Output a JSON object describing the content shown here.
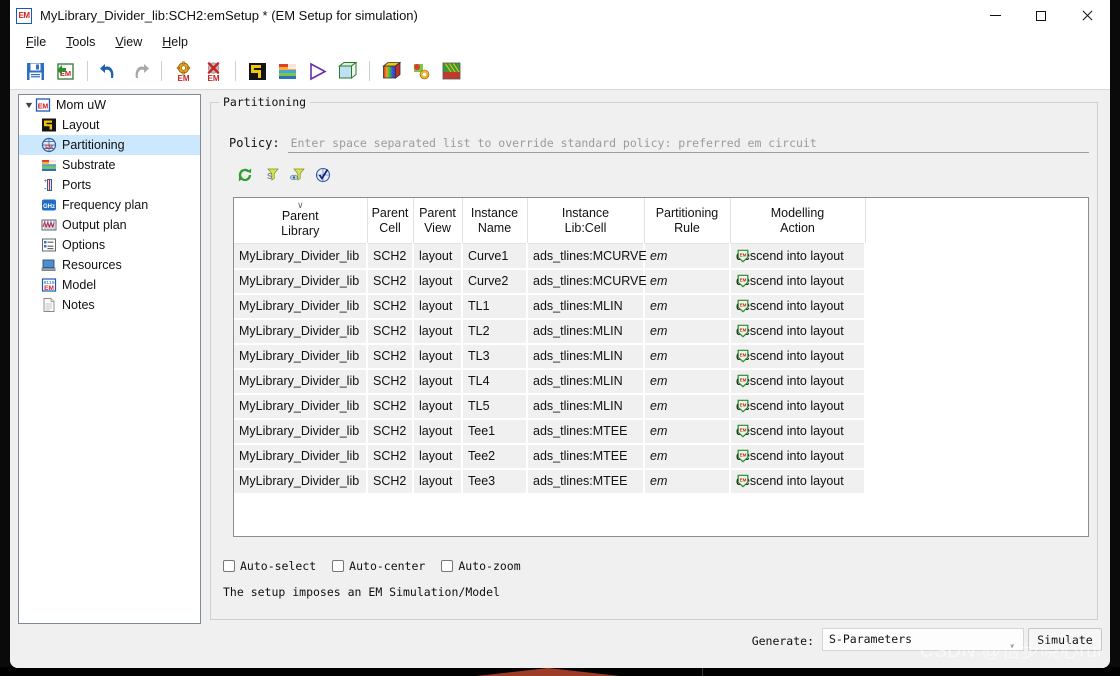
{
  "window": {
    "title": "MyLibrary_Divider_lib:SCH2:emSetup * (EM Setup for simulation)",
    "app_icon_label": "EM",
    "minimize_label": "Minimize",
    "maximize_label": "Maximize",
    "close_label": "Close"
  },
  "menu": {
    "items": [
      {
        "label": "File",
        "accel": "F"
      },
      {
        "label": "Tools",
        "accel": "T"
      },
      {
        "label": "View",
        "accel": "V"
      },
      {
        "label": "Help",
        "accel": "H"
      }
    ]
  },
  "toolbar": {
    "buttons": [
      {
        "name": "save-icon",
        "title": "Save"
      },
      {
        "name": "save-em-setup-icon",
        "title": "Save EM Setup"
      },
      {
        "name": "undo-icon",
        "title": "Undo"
      },
      {
        "name": "redo-icon",
        "title": "Redo"
      },
      {
        "name": "em-settings-icon",
        "title": "EM Setup"
      },
      {
        "name": "em-delete-icon",
        "title": "Remove EM Setup"
      },
      {
        "name": "layout-icon",
        "title": "Layout"
      },
      {
        "name": "substrate-icon",
        "title": "Substrate"
      },
      {
        "name": "simulate-icon",
        "title": "Simulate"
      },
      {
        "name": "cube-3d-icon",
        "title": "3D View"
      },
      {
        "name": "rainbow-cube-icon",
        "title": "Visualization"
      },
      {
        "name": "mesh-settings-icon",
        "title": "Mesh Settings"
      },
      {
        "name": "em-result-icon",
        "title": "EM Results"
      }
    ]
  },
  "sidebar": {
    "root": {
      "label": "Mom uW",
      "icon": "em-icon",
      "expanded": true
    },
    "items": [
      {
        "label": "Layout",
        "icon": "layout-icon",
        "selected": false
      },
      {
        "label": "Partitioning",
        "icon": "partitioning-icon",
        "selected": true
      },
      {
        "label": "Substrate",
        "icon": "substrate-icon",
        "selected": false
      },
      {
        "label": "Ports",
        "icon": "ports-icon",
        "selected": false
      },
      {
        "label": "Frequency plan",
        "icon": "ghz-icon",
        "selected": false
      },
      {
        "label": "Output plan",
        "icon": "output-plan-icon",
        "selected": false
      },
      {
        "label": "Options",
        "icon": "options-icon",
        "selected": false
      },
      {
        "label": "Resources",
        "icon": "resources-icon",
        "selected": false
      },
      {
        "label": "Model",
        "icon": "model-icon",
        "selected": false
      },
      {
        "label": "Notes",
        "icon": "notes-icon",
        "selected": false
      }
    ]
  },
  "panel": {
    "group_title": "Partitioning",
    "policy_label": "Policy:",
    "policy_value": "",
    "policy_placeholder": "Enter space separated list to override standard policy: preferred em circuit",
    "mini_toolbar": [
      {
        "name": "refresh-icon",
        "title": "Refresh"
      },
      {
        "name": "filter-s-icon",
        "title": "Filter schematic"
      },
      {
        "name": "filter-view-icon",
        "title": "Filter view"
      },
      {
        "name": "validate-em-icon",
        "title": "Validate"
      }
    ]
  },
  "table": {
    "sort_column": 0,
    "sort_indicator": "∨",
    "headers": [
      {
        "line1": "Parent",
        "line2": "Library"
      },
      {
        "line1": "Parent",
        "line2": "Cell"
      },
      {
        "line1": "Parent",
        "line2": "View"
      },
      {
        "line1": "Instance",
        "line2": "Name"
      },
      {
        "line1": "Instance",
        "line2": "Lib:Cell"
      },
      {
        "line1": "Partitioning",
        "line2": "Rule"
      },
      {
        "line1": "Modelling",
        "line2": "Action"
      }
    ],
    "rows": [
      {
        "parent_library": "MyLibrary_Divider_lib",
        "parent_cell": "SCH2",
        "parent_view": "layout",
        "instance_name": "Curve1",
        "instance_libcell": "ads_tlines:MCURVE",
        "rule": "em",
        "action": "descend into layout",
        "action_icon": "em-shield-icon"
      },
      {
        "parent_library": "MyLibrary_Divider_lib",
        "parent_cell": "SCH2",
        "parent_view": "layout",
        "instance_name": "Curve2",
        "instance_libcell": "ads_tlines:MCURVE",
        "rule": "em",
        "action": "descend into layout",
        "action_icon": "em-shield-icon"
      },
      {
        "parent_library": "MyLibrary_Divider_lib",
        "parent_cell": "SCH2",
        "parent_view": "layout",
        "instance_name": "TL1",
        "instance_libcell": "ads_tlines:MLIN",
        "rule": "em",
        "action": "descend into layout",
        "action_icon": "em-shield-icon"
      },
      {
        "parent_library": "MyLibrary_Divider_lib",
        "parent_cell": "SCH2",
        "parent_view": "layout",
        "instance_name": "TL2",
        "instance_libcell": "ads_tlines:MLIN",
        "rule": "em",
        "action": "descend into layout",
        "action_icon": "em-shield-icon"
      },
      {
        "parent_library": "MyLibrary_Divider_lib",
        "parent_cell": "SCH2",
        "parent_view": "layout",
        "instance_name": "TL3",
        "instance_libcell": "ads_tlines:MLIN",
        "rule": "em",
        "action": "descend into layout",
        "action_icon": "em-shield-icon"
      },
      {
        "parent_library": "MyLibrary_Divider_lib",
        "parent_cell": "SCH2",
        "parent_view": "layout",
        "instance_name": "TL4",
        "instance_libcell": "ads_tlines:MLIN",
        "rule": "em",
        "action": "descend into layout",
        "action_icon": "em-shield-icon"
      },
      {
        "parent_library": "MyLibrary_Divider_lib",
        "parent_cell": "SCH2",
        "parent_view": "layout",
        "instance_name": "TL5",
        "instance_libcell": "ads_tlines:MLIN",
        "rule": "em",
        "action": "descend into layout",
        "action_icon": "em-shield-icon"
      },
      {
        "parent_library": "MyLibrary_Divider_lib",
        "parent_cell": "SCH2",
        "parent_view": "layout",
        "instance_name": "Tee1",
        "instance_libcell": "ads_tlines:MTEE",
        "rule": "em",
        "action": "descend into layout",
        "action_icon": "em-shield-icon"
      },
      {
        "parent_library": "MyLibrary_Divider_lib",
        "parent_cell": "SCH2",
        "parent_view": "layout",
        "instance_name": "Tee2",
        "instance_libcell": "ads_tlines:MTEE",
        "rule": "em",
        "action": "descend into layout",
        "action_icon": "em-shield-icon"
      },
      {
        "parent_library": "MyLibrary_Divider_lib",
        "parent_cell": "SCH2",
        "parent_view": "layout",
        "instance_name": "Tee3",
        "instance_libcell": "ads_tlines:MTEE",
        "rule": "em",
        "action": "descend into layout",
        "action_icon": "em-shield-icon"
      }
    ]
  },
  "options": {
    "checkboxes": [
      {
        "label": "Auto-select",
        "checked": false
      },
      {
        "label": "Auto-center",
        "checked": false
      },
      {
        "label": "Auto-zoom",
        "checked": false
      }
    ],
    "status_text": "The setup imposes an EM Simulation/Model"
  },
  "footer": {
    "generate_label": "Generate:",
    "generate_value": "S-Parameters",
    "simulate_label": "Simulate"
  },
  "watermark": {
    "text": "CSDN @怡步晓心rui"
  },
  "colors": {
    "selection": "#cce8ff",
    "row_bg": "#f0f0f0",
    "panel_bg": "#f0f0f0",
    "border": "#8d8d8d",
    "accent_red": "#cc2222"
  }
}
